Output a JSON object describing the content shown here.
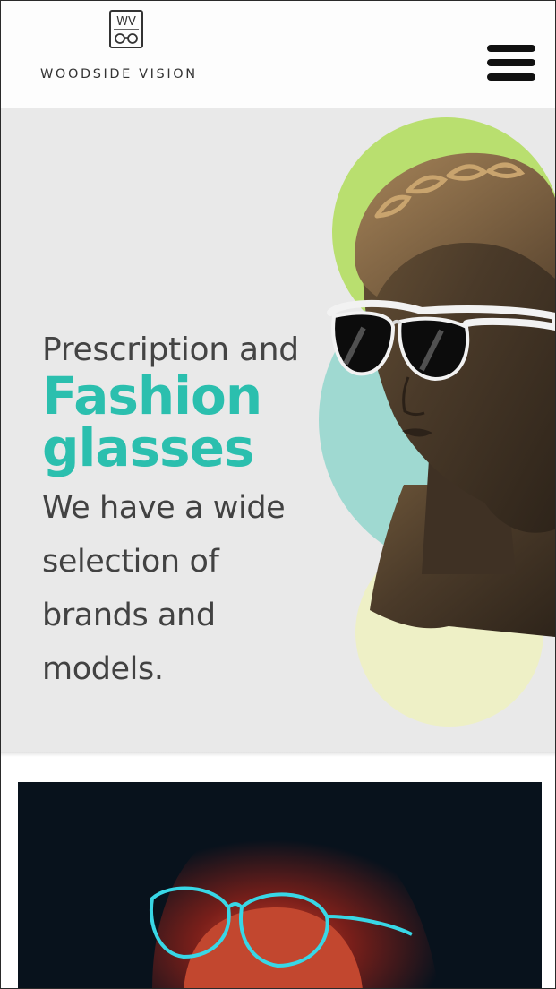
{
  "brand": {
    "name": "WOODSIDE VISION",
    "monogram": "WV"
  },
  "nav": {
    "menu_icon": "hamburger-menu-icon"
  },
  "hero": {
    "line1": "Prescription and",
    "line2a": "Fashion",
    "line2b": "glasses",
    "description_lines": [
      "We have a wide",
      "selection of",
      "brands and",
      "models."
    ],
    "illustration": "statue-bust-with-sunglasses",
    "colors": {
      "background": "#e9e9e9",
      "accent": "#2bbfae",
      "circle_green": "#b9df6f",
      "circle_teal": "#9fd9d1",
      "circle_yellow": "#eef0c6"
    }
  },
  "section2": {
    "photo": "woman-with-neon-sunglasses-photo"
  }
}
